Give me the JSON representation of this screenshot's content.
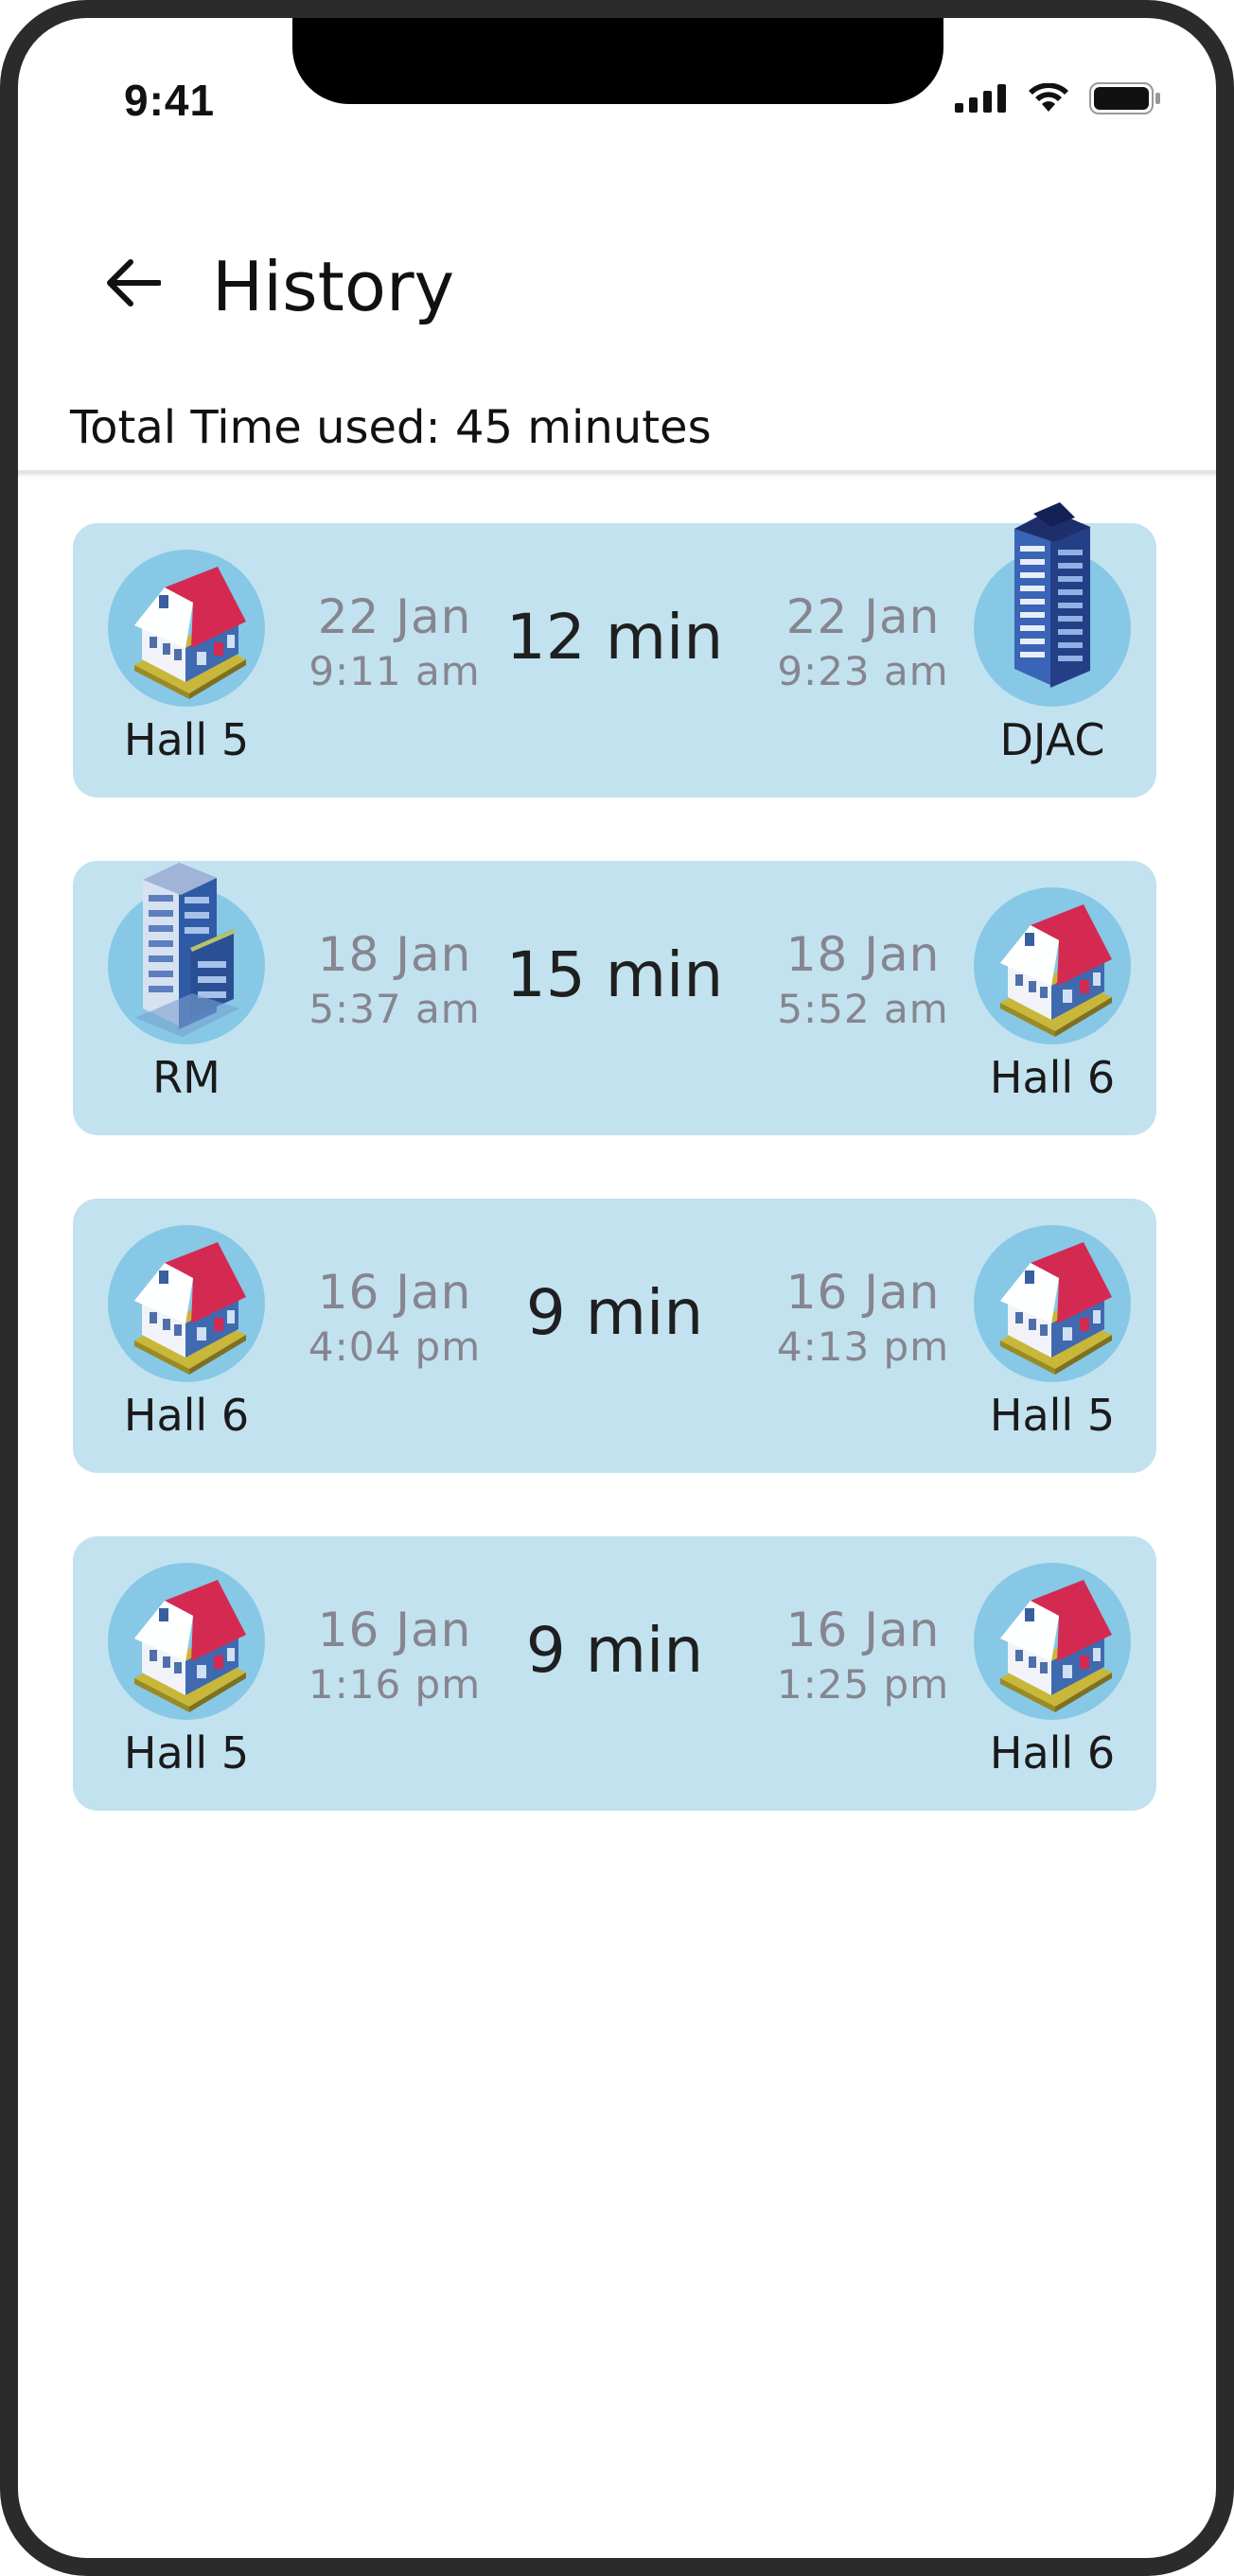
{
  "status_bar": {
    "time": "9:41",
    "icons": [
      "signal-icon",
      "wifi-icon",
      "battery-icon"
    ]
  },
  "header": {
    "title": "History",
    "back_icon": "arrow-left-icon"
  },
  "summary": {
    "total_time": "Total Time used: 45 minutes"
  },
  "colors": {
    "card_bg": "#c2e2ef",
    "icon_circle": "#86c8e6",
    "muted_text": "#868590"
  },
  "trips": [
    {
      "from": {
        "name": "Hall 5",
        "icon": "house-icon"
      },
      "start": {
        "date": "22 Jan",
        "time": "9:11 am"
      },
      "duration": "12 min",
      "end": {
        "date": "22 Jan",
        "time": "9:23 am"
      },
      "to": {
        "name": "DJAC",
        "icon": "tower-icon"
      }
    },
    {
      "from": {
        "name": "RM",
        "icon": "building-icon"
      },
      "start": {
        "date": "18 Jan",
        "time": "5:37 am"
      },
      "duration": "15 min",
      "end": {
        "date": "18 Jan",
        "time": "5:52 am"
      },
      "to": {
        "name": "Hall 6",
        "icon": "house-icon"
      }
    },
    {
      "from": {
        "name": "Hall 6",
        "icon": "house-icon"
      },
      "start": {
        "date": "16 Jan",
        "time": "4:04 pm"
      },
      "duration": "9 min",
      "end": {
        "date": "16 Jan",
        "time": "4:13 pm"
      },
      "to": {
        "name": "Hall 5",
        "icon": "house-icon"
      }
    },
    {
      "from": {
        "name": "Hall 5",
        "icon": "house-icon"
      },
      "start": {
        "date": "16 Jan",
        "time": "1:16 pm"
      },
      "duration": "9 min",
      "end": {
        "date": "16 Jan",
        "time": "1:25 pm"
      },
      "to": {
        "name": "Hall 6",
        "icon": "house-icon"
      }
    }
  ]
}
